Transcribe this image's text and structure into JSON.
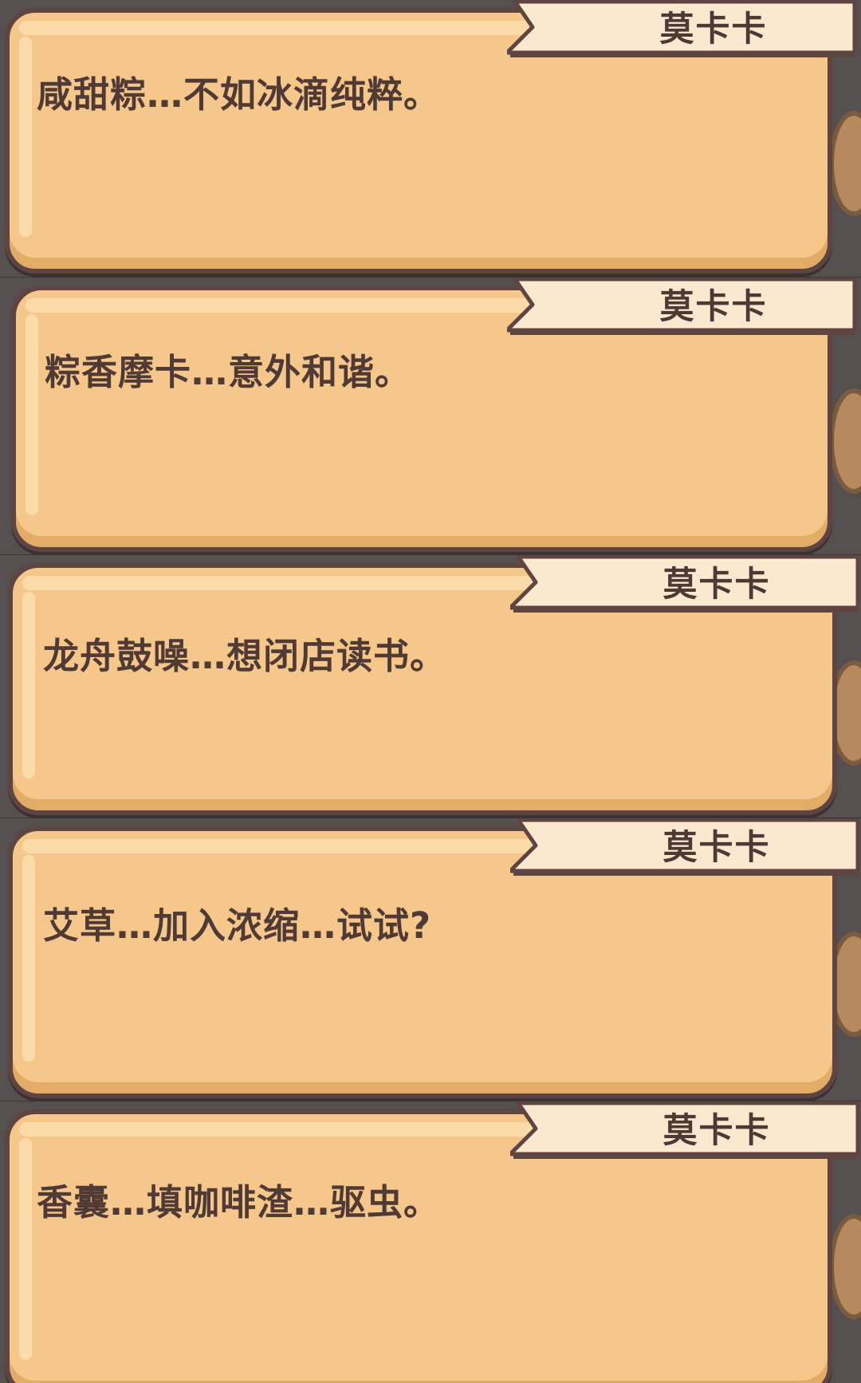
{
  "dialogs": [
    {
      "speaker": "莫卡卡",
      "text": "咸甜粽…不如冰滴纯粹。"
    },
    {
      "speaker": "莫卡卡",
      "text": "粽香摩卡…意外和谐。"
    },
    {
      "speaker": "莫卡卡",
      "text": "龙舟鼓噪…想闭店读书。"
    },
    {
      "speaker": "莫卡卡",
      "text": "艾草…加入浓缩…试试?"
    },
    {
      "speaker": "莫卡卡",
      "text": "香囊…填咖啡渣…驱虫。"
    }
  ],
  "colors": {
    "bubble_fill": "#f5c78a",
    "bubble_outline": "#5e4542",
    "name_tag_fill": "#fbe8cf",
    "text": "#4f3a35",
    "background": "#4a4546"
  }
}
